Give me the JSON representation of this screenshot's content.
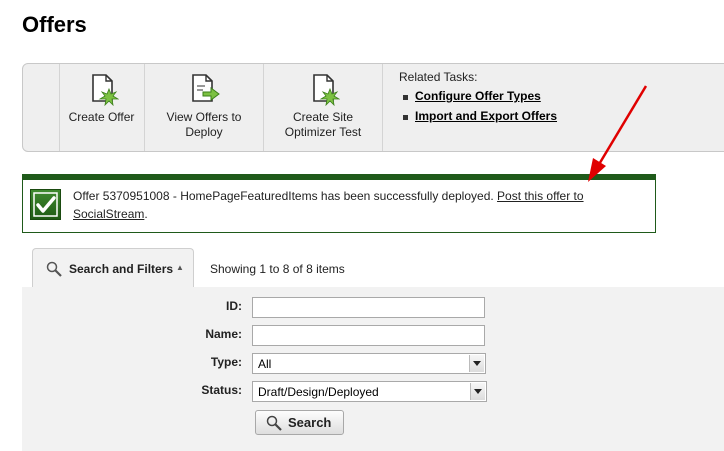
{
  "page": {
    "title": "Offers"
  },
  "toolbar": {
    "buttons": [
      {
        "label": "Create Offer",
        "icon": "create-offer-icon"
      },
      {
        "label": "View Offers to\nDeploy",
        "icon": "view-deploy-icon"
      },
      {
        "label": "Create Site\nOptimizer Test",
        "icon": "create-test-icon"
      }
    ],
    "related": {
      "title": "Related Tasks:",
      "links": [
        "Configure Offer Types",
        "Import and Export Offers"
      ]
    }
  },
  "message": {
    "text": "Offer 5370951008 - HomePageFeaturedItems has been successfully deployed. ",
    "link": "Post this offer to SocialStream",
    "end": "."
  },
  "search": {
    "tab_label": "Search and Filters",
    "showing": "Showing 1 to 8 of 8 items",
    "fields": {
      "id_label": "ID:",
      "id_value": "",
      "name_label": "Name:",
      "name_value": "",
      "type_label": "Type:",
      "type_value": "All",
      "status_label": "Status:",
      "status_value": "Draft/Design/Deployed"
    },
    "button": "Search"
  },
  "colors": {
    "success_green": "#1f5a1a",
    "arrow_red": "#e00000"
  }
}
